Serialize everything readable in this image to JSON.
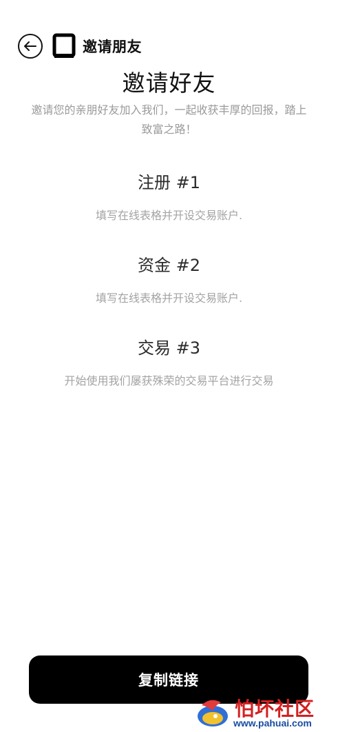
{
  "header": {
    "title": "邀请朋友"
  },
  "main": {
    "title": "邀请好友",
    "subtitle": "邀请您的亲朋好友加入我们，一起收获丰厚的回报，踏上致富之路！",
    "steps": [
      {
        "title": "注册 #1",
        "desc": "填写在线表格并开设交易账户."
      },
      {
        "title": "资金 #2",
        "desc": "填写在线表格并开设交易账户."
      },
      {
        "title": "交易 #3",
        "desc": "开始使用我们屡获殊荣的交易平台进行交易"
      }
    ]
  },
  "footer": {
    "copy_label": "复制链接"
  },
  "watermark": {
    "text": "怕坏社区",
    "url": "www.pahuai.com"
  }
}
